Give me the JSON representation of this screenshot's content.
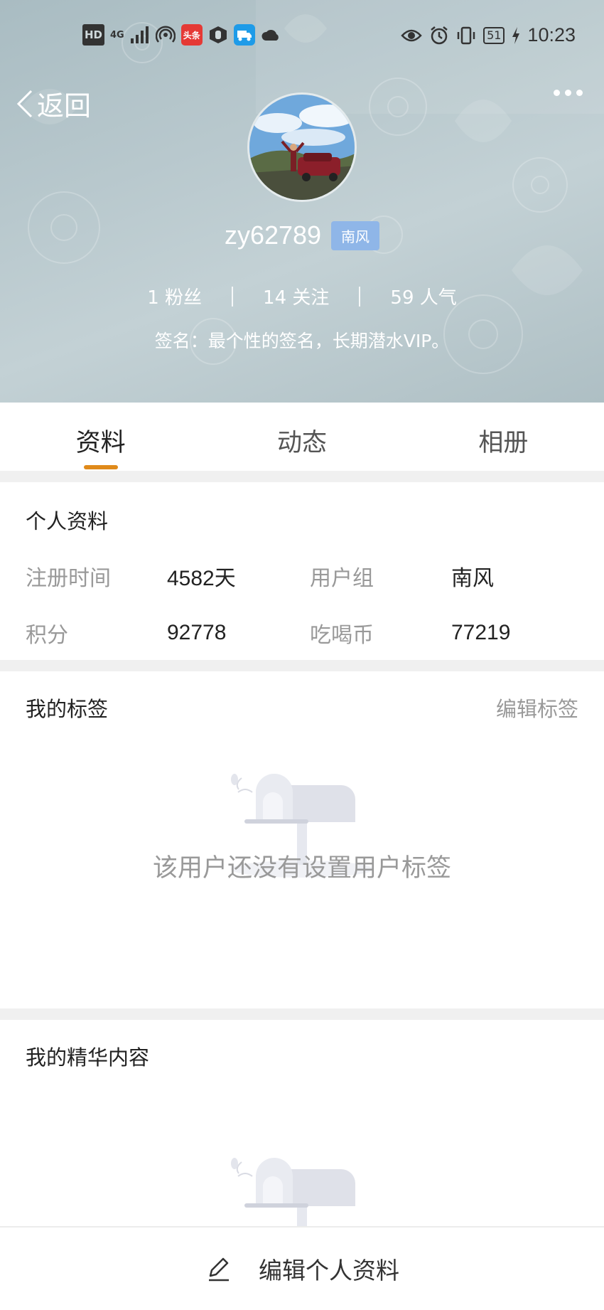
{
  "status_bar": {
    "hd": "HD",
    "network": "4G",
    "toutiao_app": "头条",
    "battery": "51",
    "time": "10:23"
  },
  "header": {
    "back_label": "返回",
    "username": "zy62789",
    "user_badge": "南风",
    "stats": [
      {
        "label": "1 粉丝"
      },
      {
        "label": "14 关注"
      },
      {
        "label": "59 人气"
      }
    ],
    "signature": "签名：最个性的签名，长期潜水VIP。"
  },
  "tabs": [
    {
      "label": "资料",
      "active": true
    },
    {
      "label": "动态",
      "active": false
    },
    {
      "label": "相册",
      "active": false
    }
  ],
  "profile": {
    "title": "个人资料",
    "rows": [
      [
        {
          "key": "注册时间",
          "value": "4582天"
        },
        {
          "key": "用户组",
          "value": "南风"
        }
      ],
      [
        {
          "key": "积分",
          "value": "92778"
        },
        {
          "key": "吃喝币",
          "value": "77219"
        }
      ]
    ]
  },
  "tags_section": {
    "title": "我的标签",
    "edit_label": "编辑标签",
    "empty_text": "该用户还没有设置用户标签"
  },
  "featured_section": {
    "title": "我的精华内容"
  },
  "bottom_bar": {
    "edit_profile_label": "编辑个人资料"
  },
  "colors": {
    "accent": "#e08a1a",
    "badge": "#8fb6e8",
    "hero_bg": "#b8c8cd"
  }
}
